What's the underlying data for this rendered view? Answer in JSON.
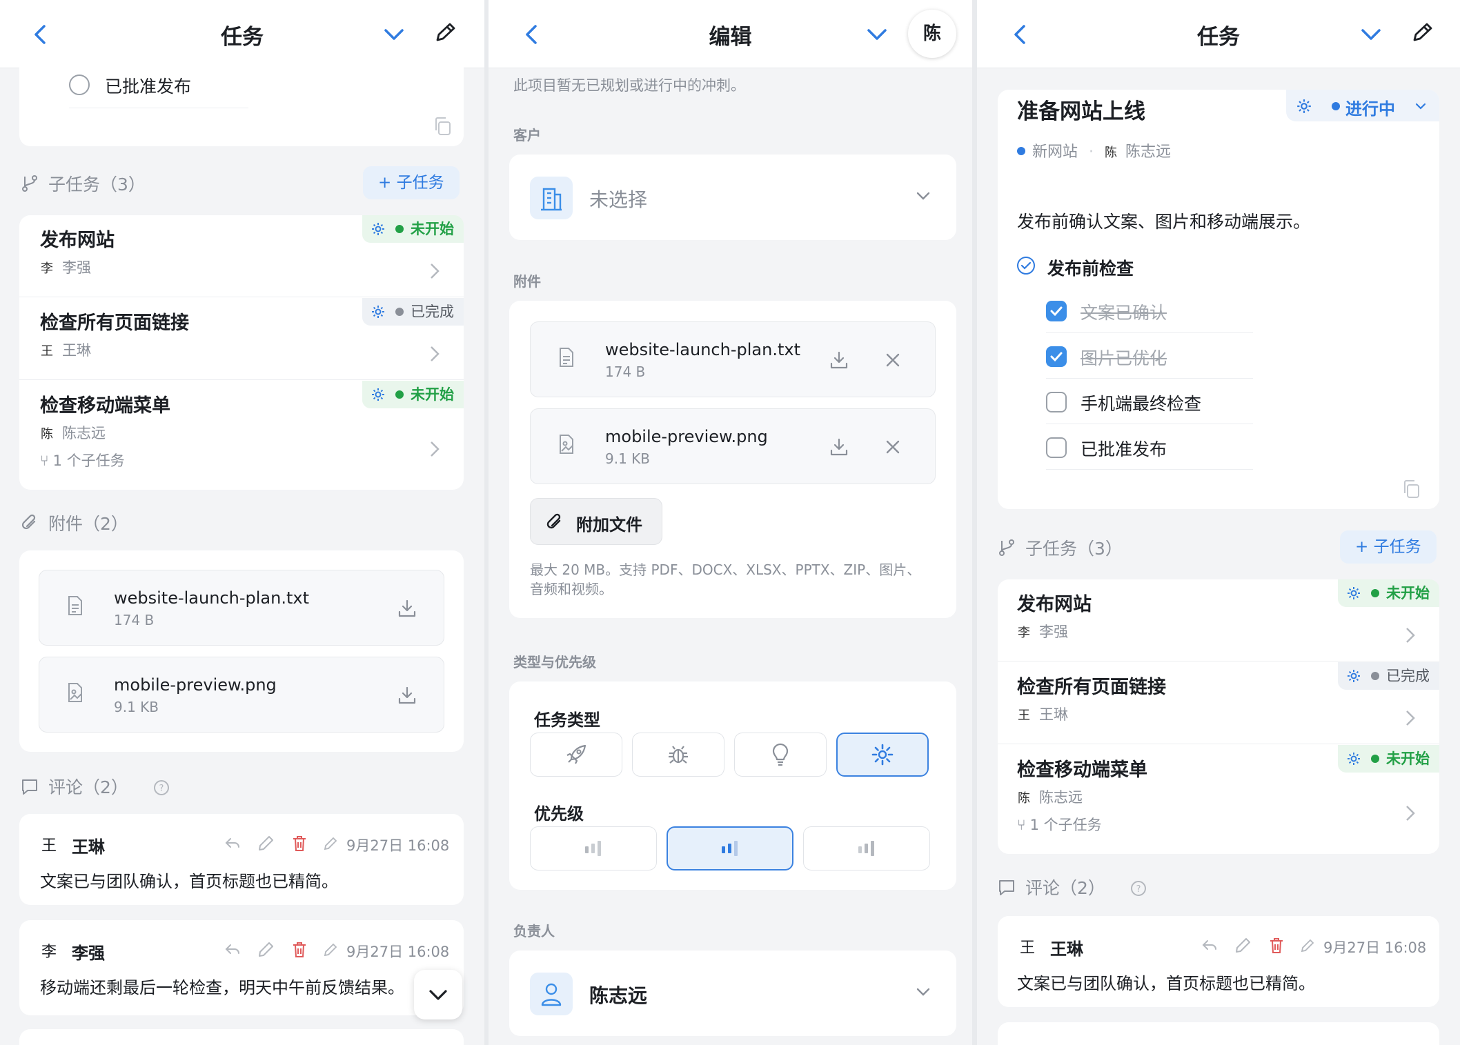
{
  "colors": {
    "accent": "#2f7be0",
    "green": "#22a046",
    "gray": "#8a8f98"
  },
  "left": {
    "header": {
      "title": "任务"
    },
    "checklist_tail": {
      "item": "已批准发布"
    },
    "subtasks": {
      "heading": "子任务（3）",
      "add_label": "+ 子任务",
      "items": [
        {
          "title": "发布网站",
          "user": "李强",
          "status": "未开始",
          "subcount": ""
        },
        {
          "title": "检查所有页面链接",
          "user": "王琳",
          "status": "已完成",
          "subcount": ""
        },
        {
          "title": "检查移动端菜单",
          "user": "陈志远",
          "status": "未开始",
          "subcount": "1 个子任务"
        }
      ]
    },
    "attachments": {
      "heading": "附件（2）",
      "files": [
        {
          "name": "website-launch-plan.txt",
          "size": "174 B"
        },
        {
          "name": "mobile-preview.png",
          "size": "9.1 KB"
        }
      ]
    },
    "comments": {
      "heading": "评论（2）",
      "items": [
        {
          "author": "王琳",
          "avatar": "王",
          "time": "9月27日 16:08",
          "text": "文案已与团队确认，首页标题也已精简。"
        },
        {
          "author": "李强",
          "avatar": "李",
          "time": "9月27日 16:08",
          "text": "移动端还剩最后一轮检查，明天中午前反馈结果。"
        }
      ]
    }
  },
  "middle": {
    "header": {
      "title": "编辑",
      "avatar": "陈"
    },
    "sprint_note": "此项目暂无已规划或进行中的冲刺。",
    "client": {
      "label": "客户",
      "value": "未选择"
    },
    "attachments": {
      "label": "附件",
      "files": [
        {
          "name": "website-launch-plan.txt",
          "size": "174 B"
        },
        {
          "name": "mobile-preview.png",
          "size": "9.1 KB"
        }
      ],
      "attach_button": "附加文件",
      "hint": "最大 20 MB。支持 PDF、DOCX、XLSX、PPTX、ZIP、图片、音频和视频。"
    },
    "type_priority": {
      "label": "类型与优先级",
      "type_label": "任务类型",
      "type_icons": [
        "rocket-icon",
        "bug-icon",
        "lightbulb-icon",
        "gear-icon"
      ],
      "selected_type": 3,
      "priority_label": "优先级",
      "selected_priority": 1
    },
    "assignee": {
      "label": "负责人",
      "value": "陈志远"
    }
  },
  "right": {
    "header": {
      "title": "任务"
    },
    "task": {
      "title": "准备网站上线",
      "status": "进行中",
      "project": "新网站",
      "owner": "陈志远",
      "description": "发布前确认文案、图片和移动端展示。",
      "checklist_title": "发布前检查",
      "checklist": [
        {
          "text": "文案已确认",
          "done": true
        },
        {
          "text": "图片已优化",
          "done": true
        },
        {
          "text": "手机端最终检查",
          "done": false
        },
        {
          "text": "已批准发布",
          "done": false
        }
      ]
    },
    "subtasks": {
      "heading": "子任务（3）",
      "add_label": "+ 子任务",
      "items": [
        {
          "title": "发布网站",
          "user": "李强",
          "status": "未开始",
          "subcount": ""
        },
        {
          "title": "检查所有页面链接",
          "user": "王琳",
          "status": "已完成",
          "subcount": ""
        },
        {
          "title": "检查移动端菜单",
          "user": "陈志远",
          "status": "未开始",
          "subcount": "1 个子任务"
        }
      ]
    },
    "comments": {
      "heading": "评论（2）",
      "items": [
        {
          "author": "王琳",
          "avatar": "王",
          "time": "9月27日 16:08",
          "text": "文案已与团队确认，首页标题也已精简。"
        }
      ]
    }
  }
}
